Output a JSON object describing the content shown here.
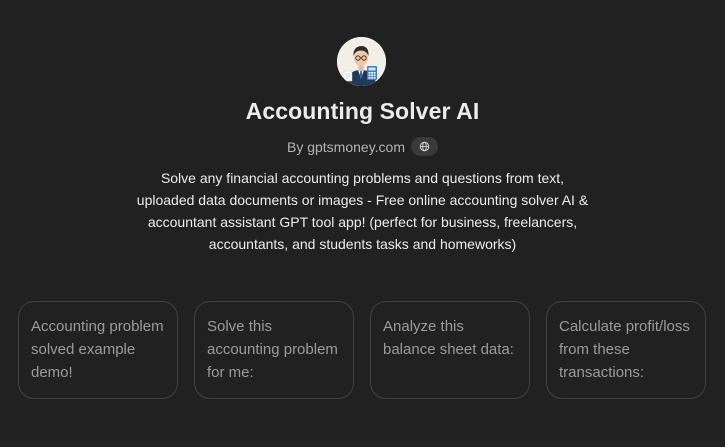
{
  "gpt": {
    "title": "Accounting Solver AI",
    "byline": "By gptsmoney.com",
    "description": "Solve any financial accounting problems and questions from text, uploaded data documents or images - Free online accounting solver AI & accountant assistant GPT tool app! (perfect for business, freelancers, accountants, and students tasks and homeworks)",
    "avatar_icon": "accountant-avatar-icon",
    "globe_icon": "globe-icon"
  },
  "starters": [
    {
      "label": "Accounting problem solved example demo!"
    },
    {
      "label": "Solve this accounting problem for me:"
    },
    {
      "label": "Analyze this balance sheet data:"
    },
    {
      "label": "Calculate profit/loss from these transactions:"
    }
  ],
  "colors": {
    "background": "#212121",
    "card_border": "#424242",
    "text_primary": "#ececec",
    "text_muted": "#9b9b9b"
  }
}
